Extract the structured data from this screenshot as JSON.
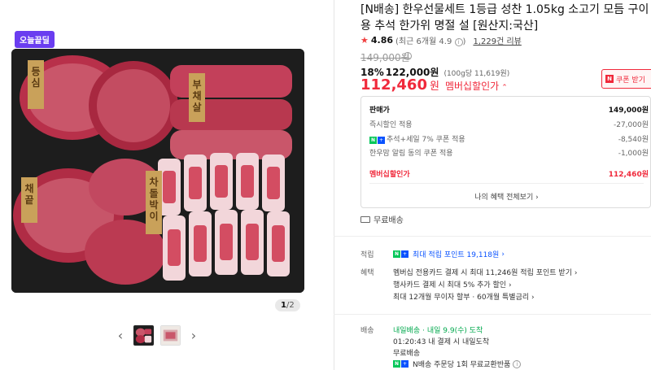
{
  "gallery": {
    "badge": "오늘끝딜",
    "page_current": "1",
    "page_total": "/2",
    "image_labels": [
      "등심",
      "부채살",
      "채끝",
      "차돌박이"
    ],
    "prev_icon": "chevron-left-icon",
    "next_icon": "chevron-right-icon"
  },
  "product": {
    "title": "[N배송] 한우선물세트 1등급 성찬 1.05kg 소고기 모듬 구이용 추석 한가위 명절 설 [원산지:국산]",
    "rating_score": "4.86",
    "rating_sub": "(최근 6개월 4.9",
    "rating_sub_close": ")",
    "review_count": "1,229건 리뷰",
    "original_price": "149,000원",
    "discount_pct": "18%",
    "sale_price": "122,000원",
    "unit_price": "(100g당 11,619원)",
    "member_price": "112,460",
    "member_won": "원",
    "member_label": "멤버십할인가",
    "coupon_label": "쿠폰 받기"
  },
  "price_box": {
    "rows": [
      {
        "label": "판매가",
        "value": "149,000원"
      },
      {
        "label": "즉시할인 적용",
        "value": "-27,000원"
      },
      {
        "label": "추석+세일 7% 쿠폰 적용",
        "value": "-8,540원"
      },
      {
        "label": "한우맘 알림 동의 쿠폰 적용",
        "value": "-1,000원"
      },
      {
        "label": "멤버십할인가",
        "value": "112,460원"
      }
    ],
    "more": "나의 혜택 전체보기"
  },
  "shipping_short": "무료배송",
  "benefits": {
    "earn_label": "적립",
    "earn_text": "최대 적립 포인트 19,118원",
    "benefit_label": "혜택",
    "benefit_lines": [
      "멤버십 전용카드 결제 시 최대 11,246원 적립 포인트 받기",
      "행사카드 결제 시 최대 5% 추가 할인",
      "최대 12개월 무이자 할부 · 60개월 특별금리"
    ]
  },
  "delivery": {
    "label": "배송",
    "line1_tag": "내일배송",
    "line1_text": "· 내일 9.9(수) 도착",
    "line2": "01:20:43  내 결제 시 내일도착",
    "line3": "무료배송",
    "line4": "N배송 주문당 1회 무료교환반품"
  },
  "colors": {
    "accent_red": "#f0293b",
    "npay_green": "#03c75a",
    "membership_blue": "#0a53ff",
    "badge_purple": "#6a3df0"
  }
}
